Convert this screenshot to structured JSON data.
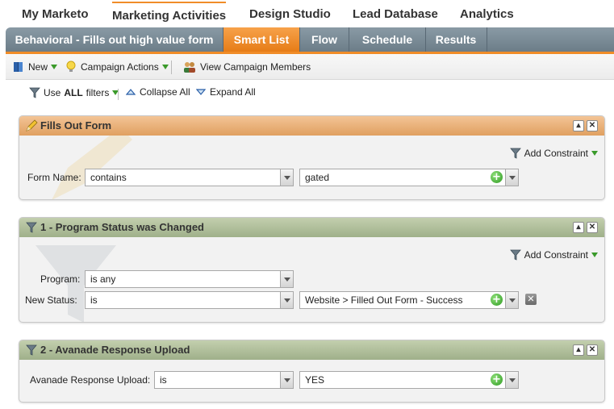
{
  "topnav": {
    "items": [
      "My Marketo",
      "Marketing Activities",
      "Design Studio",
      "Lead Database",
      "Analytics"
    ]
  },
  "tabbar": {
    "campaign_name": "Behavioral - Fills out high value form",
    "tabs": [
      "Smart List",
      "Flow",
      "Schedule",
      "Results"
    ],
    "active_tab": "Smart List"
  },
  "toolbar": {
    "new_label": "New",
    "campaign_actions_label": "Campaign Actions",
    "view_members_label": "View Campaign Members"
  },
  "filterbar": {
    "use_prefix": "Use",
    "use_all": "ALL",
    "use_suffix": "filters",
    "collapse_label": "Collapse All",
    "expand_label": "Expand All"
  },
  "filters": [
    {
      "title": "Fills Out Form",
      "add_constraint": "Add Constraint",
      "rows": [
        {
          "label": "Form Name:",
          "operator": "contains",
          "value": "gated"
        }
      ]
    },
    {
      "title": "1 - Program Status was Changed",
      "add_constraint": "Add Constraint",
      "rows": [
        {
          "label": "Program:",
          "operator": "is any"
        },
        {
          "label": "New Status:",
          "operator": "is",
          "value": "Website > Filled Out Form - Success"
        }
      ]
    },
    {
      "title": "2 - Avanade Response Upload",
      "rows": [
        {
          "label": "Avanade Response Upload:",
          "operator": "is",
          "value": "YES"
        }
      ]
    }
  ],
  "colors": {
    "accent_orange": "#f08c28",
    "tabbar_gray": "#7a8a96",
    "panel_orange": "#e8b07a",
    "panel_green": "#b0bf9a"
  },
  "icons": {
    "panel_controls": [
      "collapse-icon",
      "close-icon"
    ]
  }
}
